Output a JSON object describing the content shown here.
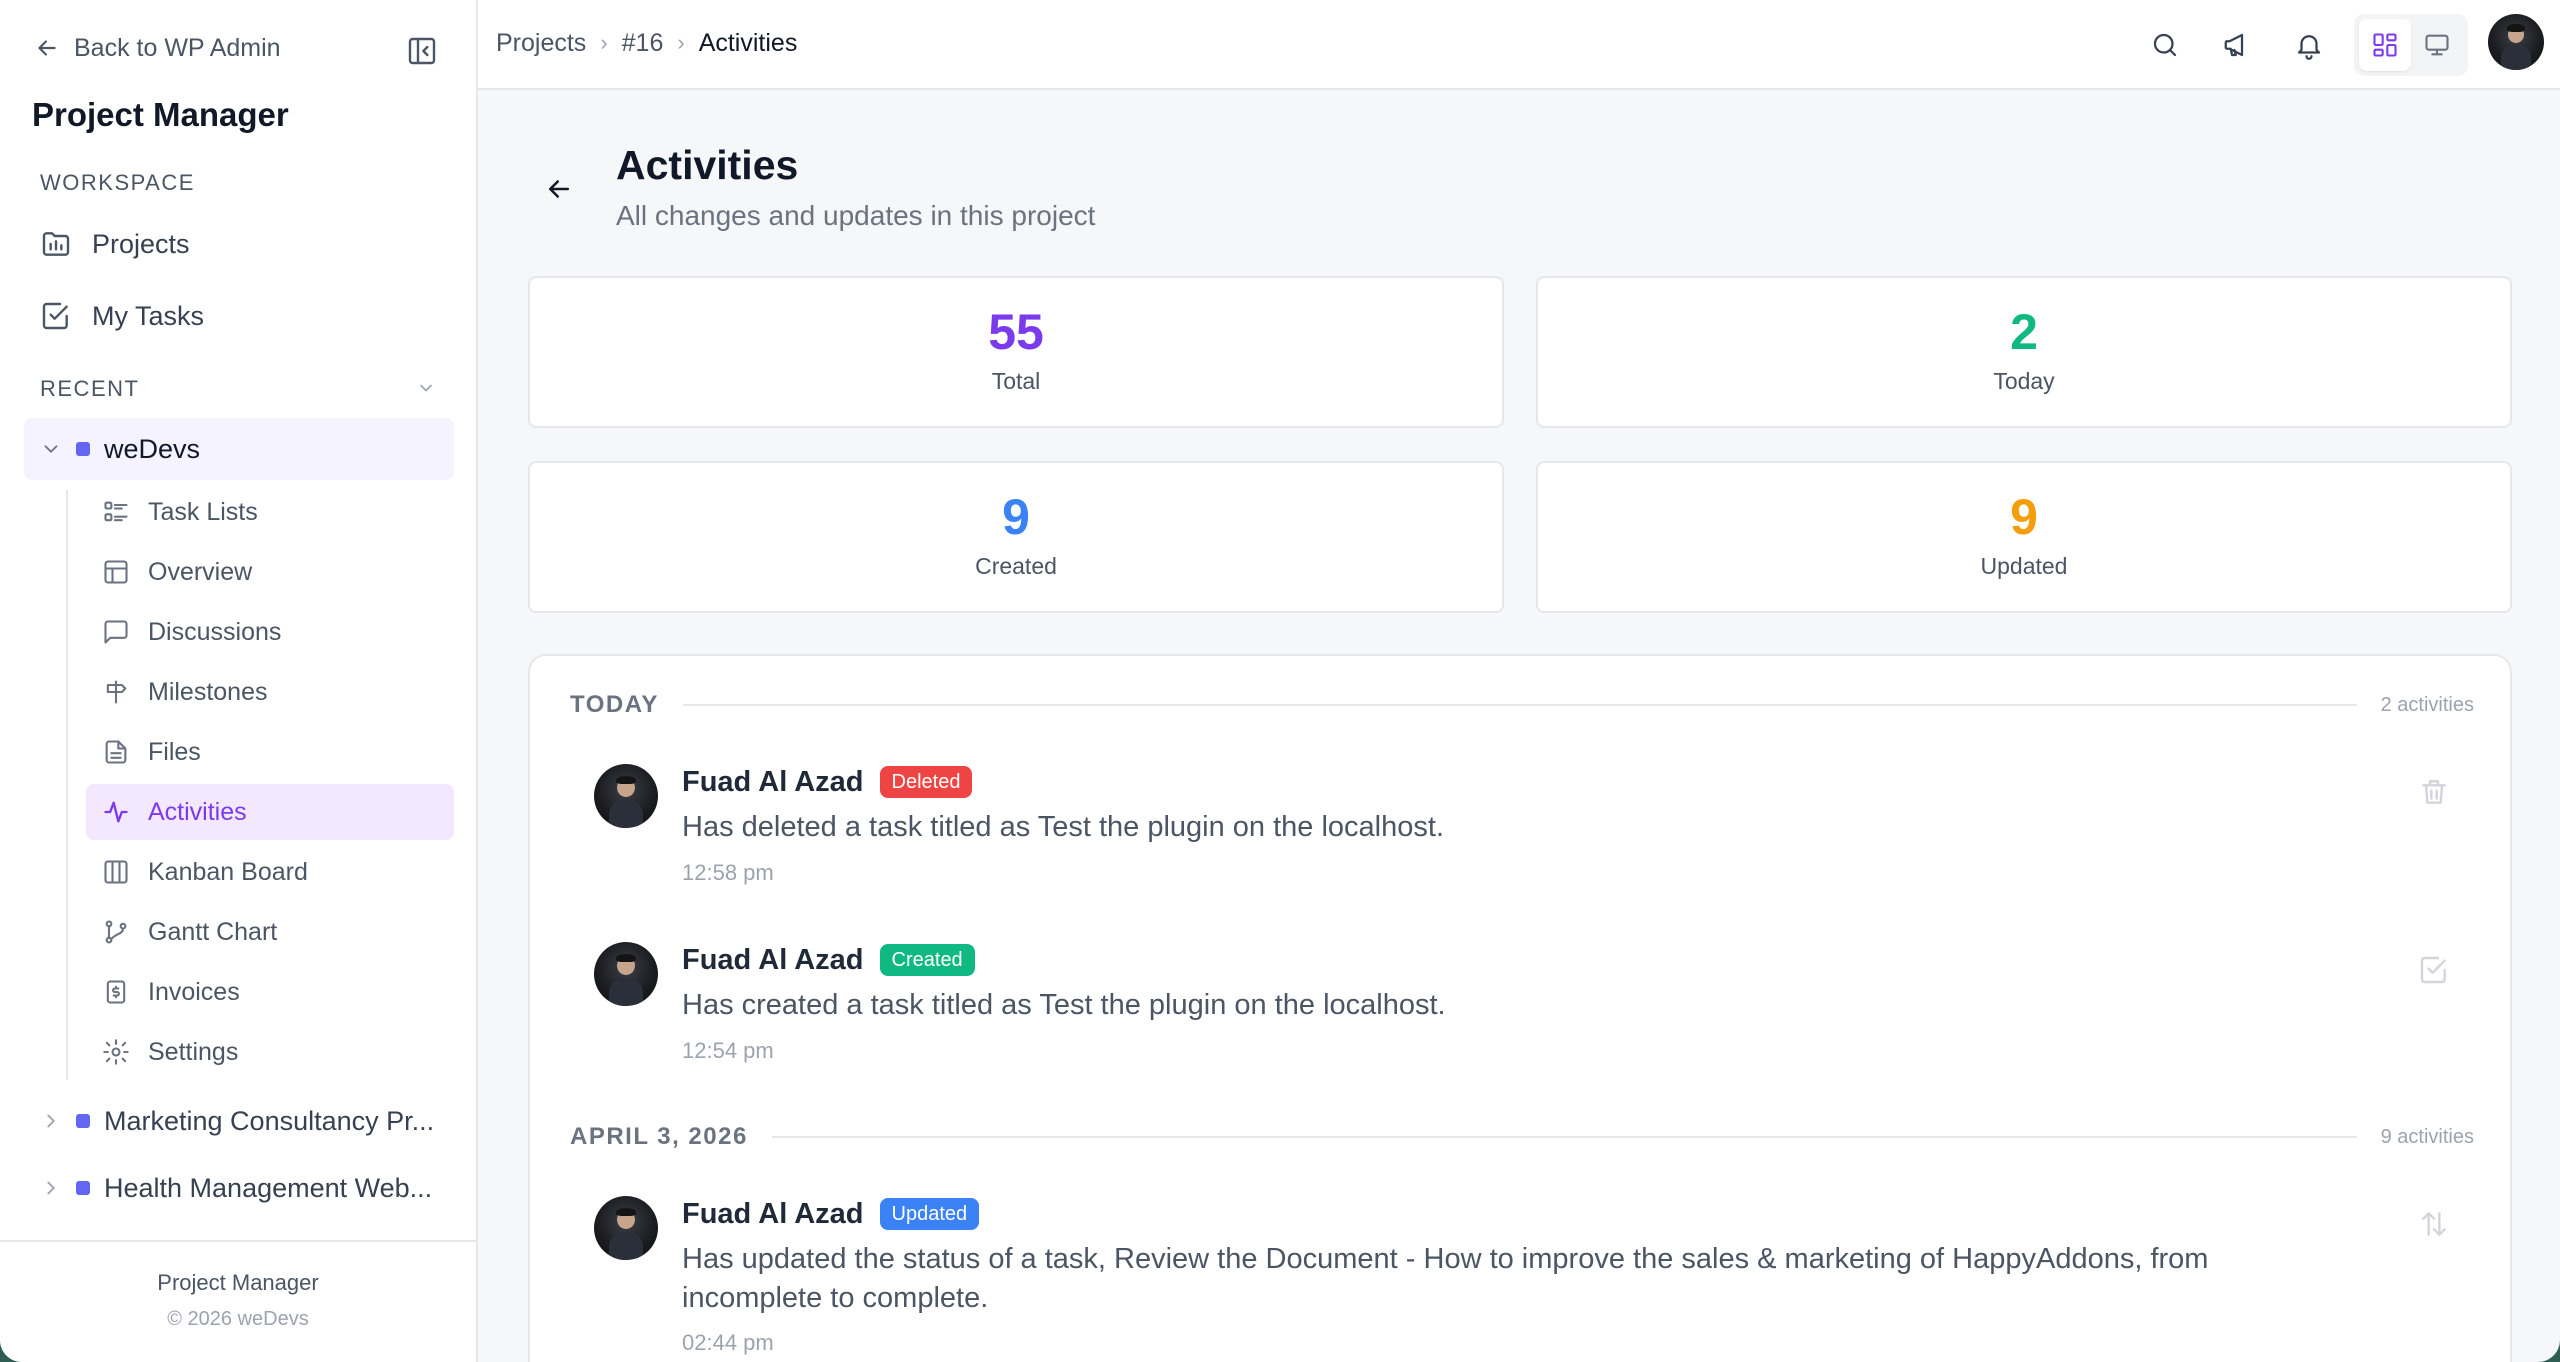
{
  "sidebar": {
    "back_label": "Back to WP Admin",
    "app_title": "Project Manager",
    "workspace_label": "WORKSPACE",
    "workspace_items": [
      {
        "label": "Projects",
        "icon": "projects-folder-icon"
      },
      {
        "label": "My Tasks",
        "icon": "checkbox-icon"
      }
    ],
    "recent_label": "RECENT",
    "projects": [
      {
        "name": "weDevs",
        "color": "#6366f1",
        "expanded": true,
        "items": [
          {
            "label": "Task Lists",
            "icon": "list-icon"
          },
          {
            "label": "Overview",
            "icon": "layout-icon"
          },
          {
            "label": "Discussions",
            "icon": "chat-icon"
          },
          {
            "label": "Milestones",
            "icon": "signpost-icon"
          },
          {
            "label": "Files",
            "icon": "file-icon"
          },
          {
            "label": "Activities",
            "icon": "activity-icon",
            "active": true
          },
          {
            "label": "Kanban Board",
            "icon": "kanban-icon"
          },
          {
            "label": "Gantt Chart",
            "icon": "gantt-icon"
          },
          {
            "label": "Invoices",
            "icon": "invoice-icon"
          },
          {
            "label": "Settings",
            "icon": "gear-icon"
          }
        ]
      },
      {
        "name": "Marketing Consultancy Pr...",
        "color": "#6366f1",
        "expanded": false
      },
      {
        "name": "Health Management Web...",
        "color": "#6366f1",
        "expanded": false
      }
    ],
    "footer_title": "Project Manager",
    "footer_copy": "© 2026 weDevs"
  },
  "topbar": {
    "breadcrumb": [
      "Projects",
      "#16",
      "Activities"
    ],
    "icons": [
      "search-icon",
      "megaphone-icon",
      "bell-icon",
      "grid-view-icon",
      "monitor-icon",
      "avatar"
    ]
  },
  "page": {
    "title": "Activities",
    "subtitle": "All changes and updates in this project"
  },
  "stats": [
    {
      "value": "55",
      "label": "Total",
      "color": "#7c3aed"
    },
    {
      "value": "2",
      "label": "Today",
      "color": "#10b981"
    },
    {
      "value": "9",
      "label": "Created",
      "color": "#3b82f6"
    },
    {
      "value": "9",
      "label": "Updated",
      "color": "#f59e0b"
    }
  ],
  "groups": [
    {
      "title": "TODAY",
      "count": "2 activities",
      "activities": [
        {
          "user": "Fuad Al Azad",
          "badge": "Deleted",
          "badge_color": "#ef4444",
          "text": "Has deleted a task titled as Test the plugin on the localhost.",
          "time": "12:58 pm",
          "icon": "trash-icon"
        },
        {
          "user": "Fuad Al Azad",
          "badge": "Created",
          "badge_color": "#10b981",
          "text": "Has created a task titled as Test the plugin on the localhost.",
          "time": "12:54 pm",
          "icon": "check-square-icon"
        }
      ]
    },
    {
      "title": "APRIL 3, 2026",
      "count": "9 activities",
      "activities": [
        {
          "user": "Fuad Al Azad",
          "badge": "Updated",
          "badge_color": "#3b82f6",
          "text": "Has updated the status of a task, Review the Document - How to improve the sales & marketing of HappyAddons, from incomplete to complete.",
          "time": "02:44 pm",
          "icon": "swap-arrows-icon"
        }
      ]
    }
  ]
}
